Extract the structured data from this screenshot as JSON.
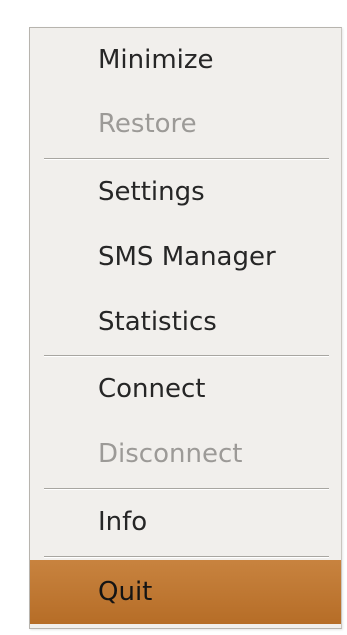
{
  "menu": {
    "items": [
      {
        "label": "Minimize",
        "enabled": true
      },
      {
        "label": "Restore",
        "enabled": false
      },
      {
        "label": "Settings",
        "enabled": true
      },
      {
        "label": "SMS Manager",
        "enabled": true
      },
      {
        "label": "Statistics",
        "enabled": true
      },
      {
        "label": "Connect",
        "enabled": true
      },
      {
        "label": "Disconnect",
        "enabled": false
      },
      {
        "label": "Info",
        "enabled": true
      },
      {
        "label": "Quit",
        "enabled": true,
        "highlighted": true
      }
    ],
    "highlight_color": "#c07a35"
  }
}
